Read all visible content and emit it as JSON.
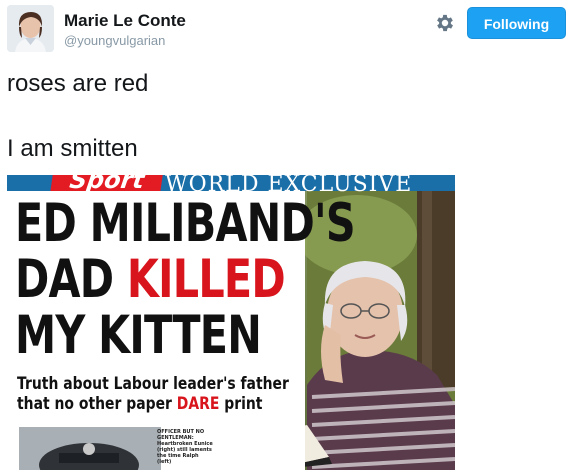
{
  "profile": {
    "name": "Marie Le Conte",
    "handle": "@youngvulgarian",
    "follow_label": "Following"
  },
  "tweet": {
    "line1": "roses are red",
    "line2": "I am smitten"
  },
  "photo": {
    "logo": "Sport",
    "banner": "WORLD EXCLUSIVE",
    "headline_1": "ED MILIBAND'S",
    "headline_2a": "DAD ",
    "headline_2b": "KILLED",
    "headline_3": "MY KITTEN",
    "subhead_1": "Truth about Labour leader's father",
    "subhead_2a": "that no other paper ",
    "subhead_2b": "DARE",
    "subhead_2c": " print",
    "caption": "OFFICER BUT NO GENTLEMAN: Heartbroken Eunice (right) still laments the time Ralph (left)"
  },
  "colors": {
    "follow_blue": "#1da1f2",
    "headline_red": "#d8141c",
    "banner_blue": "#1a6fa8"
  },
  "icons": {
    "settings": "gear-icon"
  }
}
